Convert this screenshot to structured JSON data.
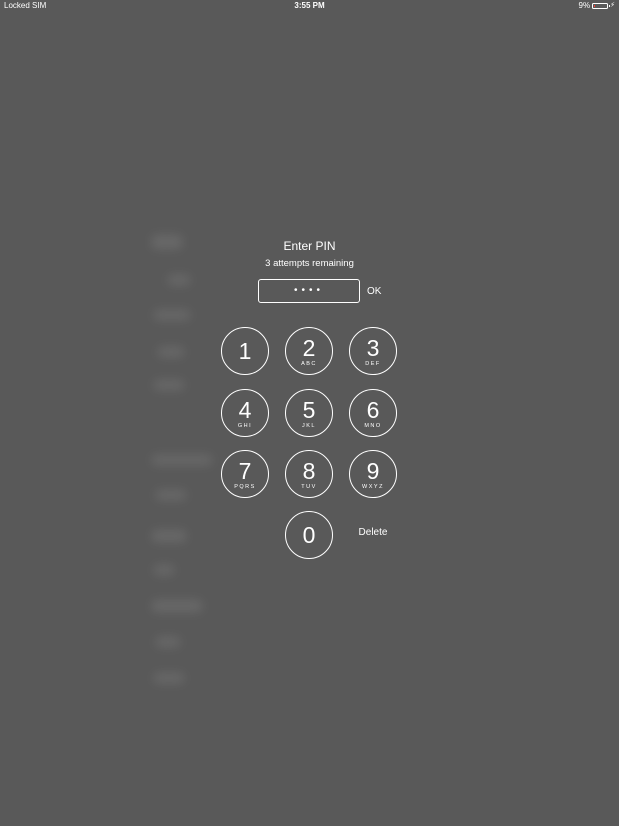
{
  "status_bar": {
    "carrier": "Locked SIM",
    "time": "3:55 PM",
    "battery_percent_label": "9%",
    "battery_level": 0.09,
    "battery_color": "#ff3b30",
    "charging_icon": "lightning-bolt-icon"
  },
  "pin_entry": {
    "title": "Enter PIN",
    "subtitle": "3 attempts remaining",
    "masked_value": "••••",
    "ok_label": "OK",
    "delete_label": "Delete"
  },
  "keypad": [
    {
      "digit": "1",
      "letters": ""
    },
    {
      "digit": "2",
      "letters": "ABC"
    },
    {
      "digit": "3",
      "letters": "DEF"
    },
    {
      "digit": "4",
      "letters": "GHI"
    },
    {
      "digit": "5",
      "letters": "JKL"
    },
    {
      "digit": "6",
      "letters": "MNO"
    },
    {
      "digit": "7",
      "letters": "PQRS"
    },
    {
      "digit": "8",
      "letters": "TUV"
    },
    {
      "digit": "9",
      "letters": "WXYZ"
    },
    {
      "digit": "0",
      "letters": ""
    }
  ],
  "colors": {
    "background": "#595959",
    "foreground": "#ffffff"
  }
}
